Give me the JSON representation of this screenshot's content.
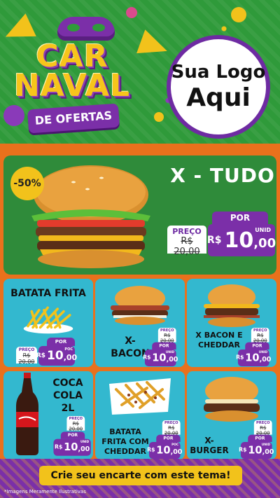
{
  "header": {
    "title_line1": "CAR",
    "title_line2": "NAVAL",
    "subtitle": "DE OFERTAS",
    "logo_line1": "Sua Logo",
    "logo_line2": "Aqui"
  },
  "featured": {
    "name": "X - TUDO",
    "discount": "-50%",
    "por": "POR",
    "preco_label": "PREÇO",
    "old_price": "R$ 20,00",
    "currency": "R$",
    "price_int": "10",
    "price_cents": ",00",
    "unit": "UNID"
  },
  "products": [
    {
      "name_line1": "BATATA FRITA",
      "name_line2": "",
      "por": "POR",
      "preco_label": "PREÇO",
      "old_price": "R$ 20,00",
      "currency": "R$",
      "price_int": "10",
      "price_cents": ",00",
      "unit": "POC"
    },
    {
      "name_line1": "X-",
      "name_line2": "BACON",
      "por": "POR",
      "preco_label": "PREÇO",
      "old_price": "R$ 20,00",
      "currency": "R$",
      "price_int": "10",
      "price_cents": ",00",
      "unit": "UNID"
    },
    {
      "name_line1": "X BACON E",
      "name_line2": "CHEDDAR",
      "por": "POR",
      "preco_label": "PREÇO",
      "old_price": "R$ 20,00",
      "currency": "R$",
      "price_int": "10",
      "price_cents": ",00",
      "unit": "UNID"
    },
    {
      "name_line1": "COCA",
      "name_line2": "COLA",
      "name_line3": "2L",
      "por": "POR",
      "preco_label": "PREÇO",
      "old_price": "R$ 20,00",
      "currency": "R$",
      "price_int": "10",
      "price_cents": ",00",
      "unit": "UNID"
    },
    {
      "name_line1": "BATATA",
      "name_line2": "FRITA COM",
      "name_line3": "CHEDDAR",
      "por": "POR",
      "preco_label": "PREÇO",
      "old_price": "R$ 20,00",
      "currency": "R$",
      "price_int": "10",
      "price_cents": ",00",
      "unit": "POC"
    },
    {
      "name_line1": "X-",
      "name_line2": "BURGER",
      "por": "POR",
      "preco_label": "PREÇO",
      "old_price": "R$ 20,00",
      "currency": "R$",
      "price_int": "10",
      "price_cents": ",00",
      "unit": "UNID"
    }
  ],
  "footer": {
    "cta": "Crie seu encarte com este tema!",
    "disclaimer": "*Imagens Meramente Ilustrativas"
  },
  "colors": {
    "purple": "#7b2fa8",
    "yellow": "#f2c21b",
    "green": "#2f8b3a",
    "cyan": "#33b8cf",
    "orange": "#e9711c"
  },
  "icons": [
    "carnival-mask-icon",
    "trumpet-icon",
    "burger-icon",
    "fries-icon",
    "soda-bottle-icon"
  ]
}
